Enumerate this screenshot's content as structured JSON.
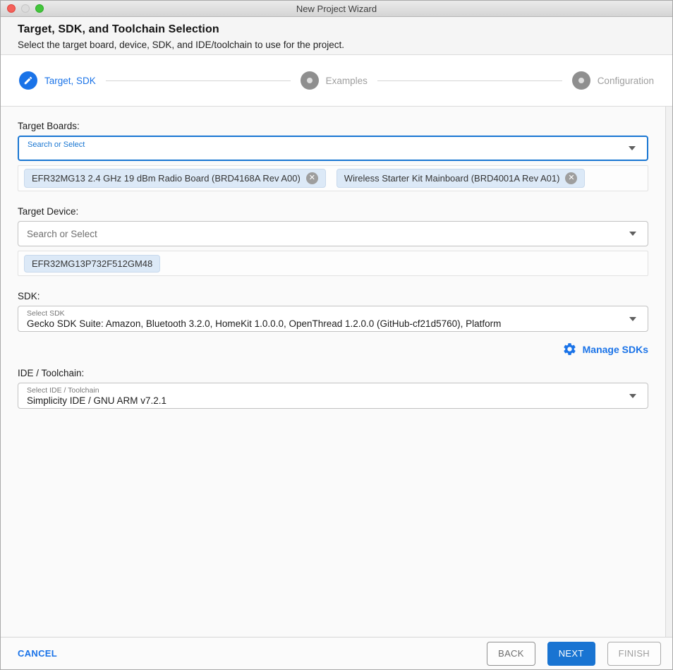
{
  "window": {
    "title": "New Project Wizard"
  },
  "header": {
    "title": "Target, SDK, and Toolchain Selection",
    "subtitle": "Select the target board, device, SDK, and IDE/toolchain to use for the project."
  },
  "stepper": {
    "steps": [
      {
        "label": "Target, SDK",
        "state": "active",
        "icon": "pencil-icon"
      },
      {
        "label": "Examples",
        "state": "upcoming",
        "icon": "dot-icon"
      },
      {
        "label": "Configuration",
        "state": "upcoming",
        "icon": "dot-icon"
      }
    ]
  },
  "form": {
    "target_boards": {
      "label": "Target Boards:",
      "input_placeholder": "Search or Select",
      "chips": [
        {
          "label": "EFR32MG13 2.4 GHz 19 dBm Radio Board (BRD4168A Rev A00)",
          "removable": true,
          "remove_glyph": "✕"
        },
        {
          "label": "Wireless Starter Kit Mainboard (BRD4001A Rev A01)",
          "removable": true,
          "remove_glyph": "✕"
        }
      ]
    },
    "target_device": {
      "label": "Target Device:",
      "input_placeholder": "Search or Select",
      "chips": [
        {
          "label": "EFR32MG13P732F512GM48",
          "removable": false
        }
      ]
    },
    "sdk": {
      "label": "SDK:",
      "select_label": "Select SDK",
      "value": "Gecko SDK Suite: Amazon, Bluetooth 3.2.0, HomeKit 1.0.0.0, OpenThread 1.2.0.0 (GitHub-cf21d5760), Platform",
      "manage_label": "Manage SDKs",
      "manage_icon": "gear-icon"
    },
    "ide_toolchain": {
      "label": "IDE / Toolchain:",
      "select_label": "Select IDE / Toolchain",
      "value": "Simplicity IDE / GNU ARM v7.2.1"
    }
  },
  "footer": {
    "cancel_label": "CANCEL",
    "back_label": "BACK",
    "next_label": "NEXT",
    "finish_label": "FINISH"
  },
  "colors": {
    "accent": "#1a73e8",
    "primary_button": "#1974d2",
    "focus_border": "#1976d2",
    "chip_bg": "#dce9f7",
    "step_inactive": "#8f8f8f"
  }
}
